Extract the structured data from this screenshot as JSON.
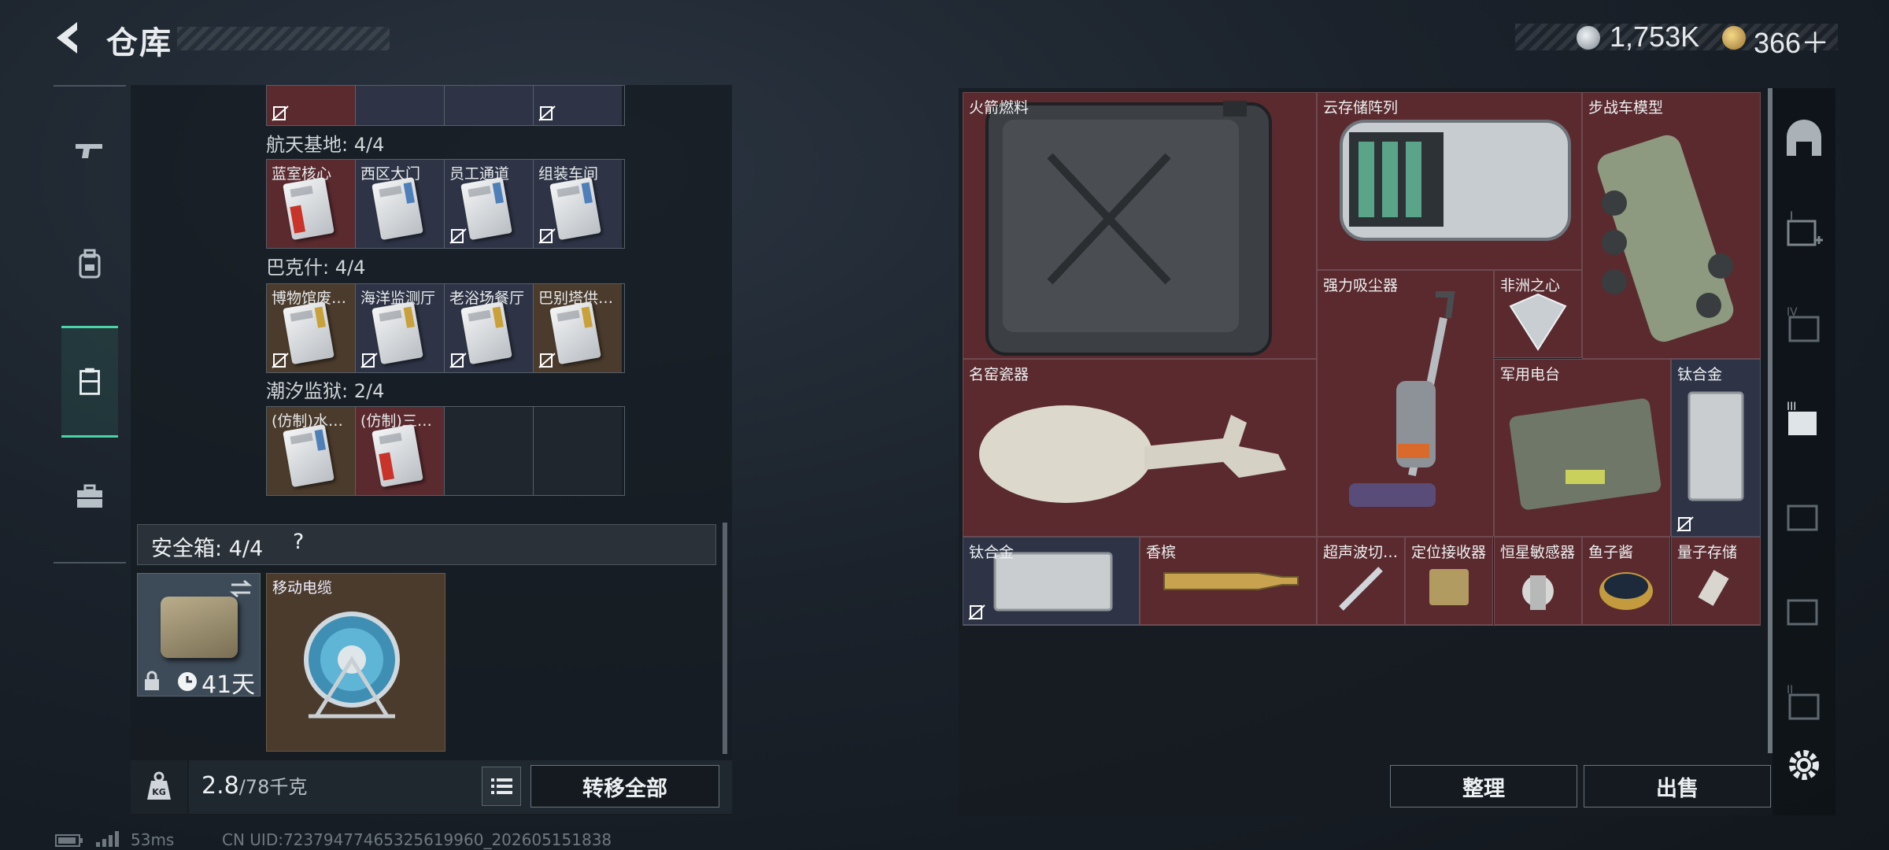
{
  "header": {
    "title": "仓库",
    "currency1": "1,753K",
    "currency2": "366＋"
  },
  "left_nav": [
    {
      "id": "weapons",
      "icon": "pistol-icon"
    },
    {
      "id": "gear",
      "icon": "backpack-icon"
    },
    {
      "id": "storage",
      "icon": "storage-icon",
      "active": true
    },
    {
      "id": "case",
      "icon": "briefcase-icon"
    }
  ],
  "groups": [
    {
      "title": "航天基地: 4/4",
      "cells": [
        "蓝室核心",
        "西区大门",
        "员工通道",
        "组装车间"
      ]
    },
    {
      "title": "巴克什: 4/4",
      "cells": [
        "博物馆废…",
        "海洋监测厅",
        "老浴场餐厅",
        "巴别塔供…"
      ]
    },
    {
      "title": "潮汐监狱: 2/4",
      "cells": [
        "(仿制)水…",
        "(仿制)三…",
        "",
        ""
      ]
    }
  ],
  "safe": {
    "label": "安全箱: 4/4",
    "help": "?",
    "days": "41天",
    "item_label": "移动电缆"
  },
  "weight": {
    "value": "2.8",
    "max": "/78千克",
    "icon": "KG"
  },
  "transfer_all": "转移全部",
  "items": {
    "rocket_fuel": "火箭燃料",
    "cloud_array": "云存储阵列",
    "ifv_model": "步战车模型",
    "vacuum": "强力吸尘器",
    "heart_africa": "非洲之心",
    "porcelain": "名窑瓷器",
    "radio": "军用电台",
    "titanium1": "钛合金",
    "titanium2": "钛合金",
    "champagne": "香槟",
    "ultrasonic": "超声波切…",
    "locator": "定位接收器",
    "star_sensor": "恒星敏感器",
    "caviar": "鱼子酱",
    "quantum": "量子存储"
  },
  "buttons": {
    "sort": "整理",
    "sell": "出售"
  },
  "footer": {
    "ping": "53ms",
    "uid": "CN UID:7237947746532561​9960_202605151838"
  }
}
